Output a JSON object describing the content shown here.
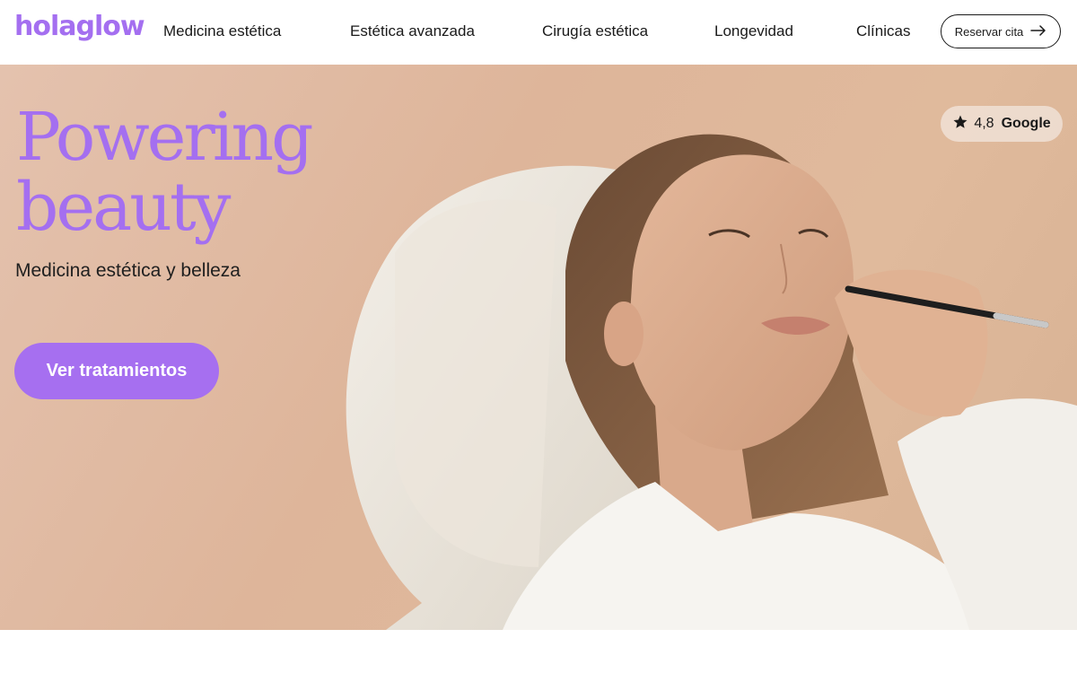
{
  "brand": {
    "logo": "holaglow",
    "accent_color": "#a46ff0"
  },
  "nav": {
    "links": [
      {
        "label": "Medicina estética"
      },
      {
        "label": "Estética avanzada"
      },
      {
        "label": "Cirugía estética"
      },
      {
        "label": "Longevidad"
      },
      {
        "label": "Clínicas"
      }
    ],
    "reserve_label": "Reservar cita",
    "reserve_icon": "arrow-right-icon"
  },
  "hero": {
    "title_line1": "Powering",
    "title_line2": "beauty",
    "subtitle": "Medicina estética y belleza",
    "cta_label": "Ver tratamientos",
    "rating": {
      "icon": "star-icon",
      "value": "4,8",
      "source": "Google"
    }
  }
}
